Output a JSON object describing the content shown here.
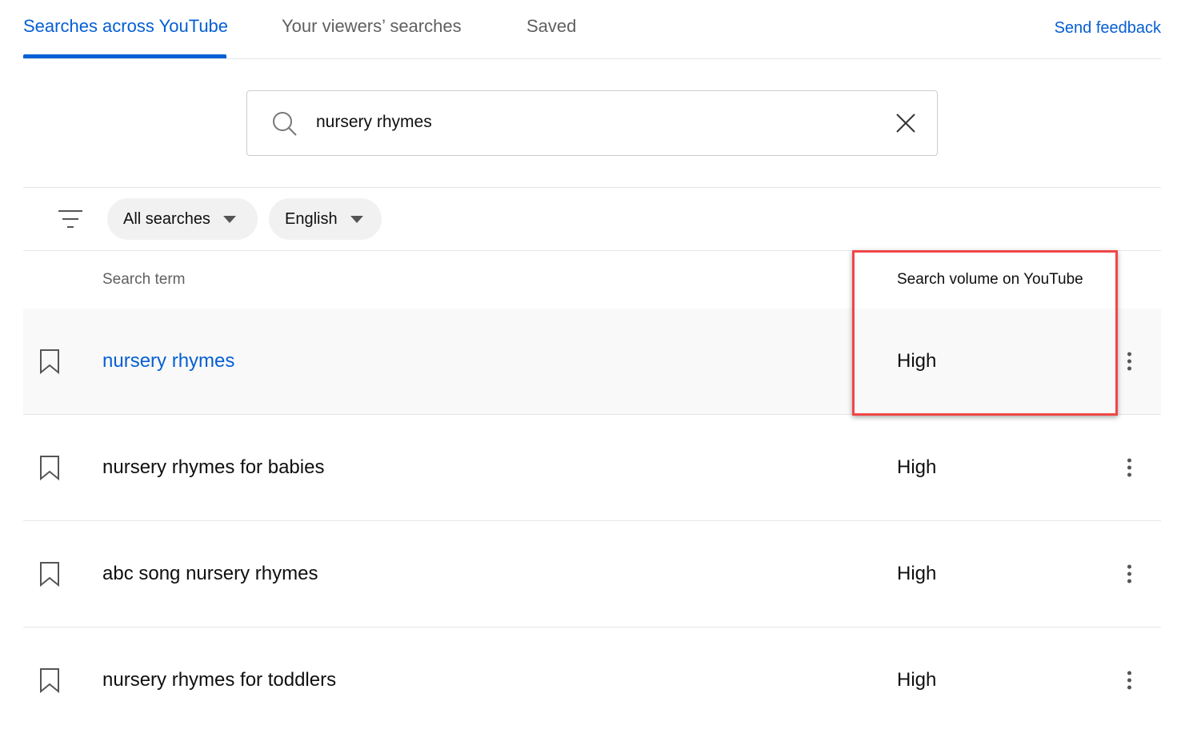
{
  "tabs": [
    {
      "label": "Searches across YouTube",
      "active": true
    },
    {
      "label": "Your viewers’ searches"
    },
    {
      "label": "Saved"
    }
  ],
  "send_feedback": "Send feedback",
  "search": {
    "value": "nursery rhymes",
    "icon": "search-icon",
    "clear_icon": "close-icon"
  },
  "filters": {
    "icon": "filter-icon",
    "chips": [
      {
        "label": "All searches"
      },
      {
        "label": "English"
      }
    ]
  },
  "table": {
    "headers": {
      "term": "Search term",
      "volume": "Search volume on YouTube"
    },
    "rows": [
      {
        "term": "nursery rhymes",
        "volume": "High",
        "highlighted": true
      },
      {
        "term": "nursery rhymes for babies",
        "volume": "High"
      },
      {
        "term": "abc song nursery rhymes",
        "volume": "High"
      },
      {
        "term": "nursery rhymes for toddlers",
        "volume": "High"
      }
    ]
  },
  "colors": {
    "accent": "#065fd4",
    "highlight_box": "#f04648",
    "row_hover": "#f9f9f9"
  }
}
